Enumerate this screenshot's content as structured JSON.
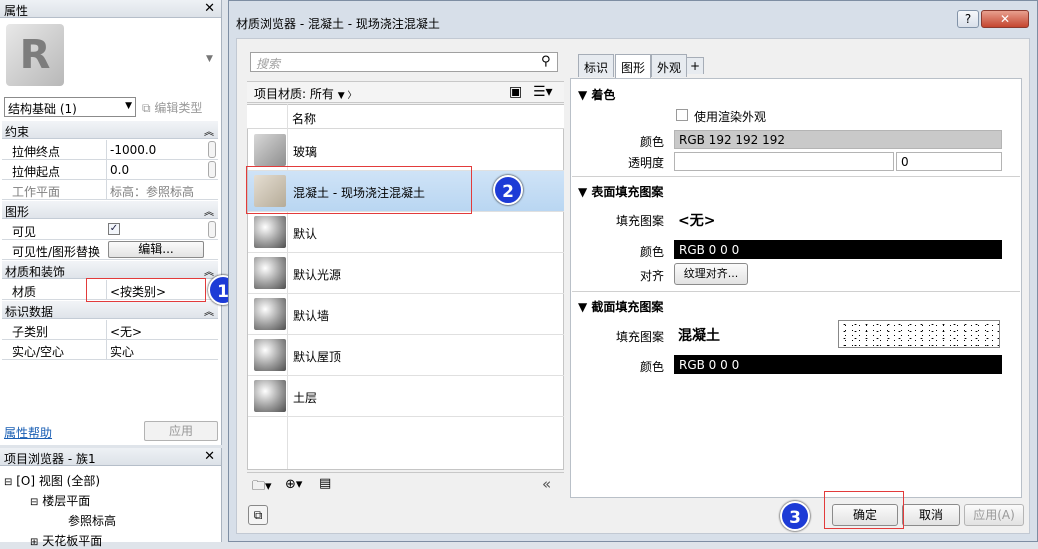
{
  "properties": {
    "title": "属性",
    "type_selector": "结构基础 (1)",
    "edit_type": "编辑类型",
    "sections": {
      "constraints": "约束",
      "graphics": "图形",
      "materials": "材质和装饰",
      "identity": "标识数据"
    },
    "rows": {
      "extrusion_end": {
        "label": "拉伸终点",
        "value": "-1000.0"
      },
      "extrusion_start": {
        "label": "拉伸起点",
        "value": "0.0"
      },
      "work_plane": {
        "label": "工作平面",
        "value": "标高：参照标高"
      },
      "visible": {
        "label": "可见",
        "value": "✓"
      },
      "vis_override": {
        "label": "可见性/图形替换",
        "button": "编辑..."
      },
      "material": {
        "label": "材质",
        "value": "<按类别>"
      },
      "subcategory": {
        "label": "子类别",
        "value": "<无>"
      },
      "solid_void": {
        "label": "实心/空心",
        "value": "实心"
      }
    },
    "help_link": "属性帮助",
    "apply": "应用"
  },
  "project_browser": {
    "title": "项目浏览器 - 族1",
    "items": [
      "视图 (全部)",
      "楼层平面",
      "参照标高",
      "天花板平面"
    ]
  },
  "dialog": {
    "title": "材质浏览器 - 混凝土 - 现场浇注混凝土",
    "help": "?",
    "search_placeholder": "搜索",
    "library": "项目材质: 所有",
    "column_name": "名称",
    "materials": [
      {
        "name": "玻璃",
        "icon": "glass"
      },
      {
        "name": "混凝土 - 现场浇注混凝土",
        "icon": "concrete",
        "selected": true
      },
      {
        "name": "默认",
        "icon": "sphere"
      },
      {
        "name": "默认光源",
        "icon": "sphere"
      },
      {
        "name": "默认墙",
        "icon": "sphere"
      },
      {
        "name": "默认屋顶",
        "icon": "sphere"
      },
      {
        "name": "土层",
        "icon": "sphere"
      }
    ],
    "tabs": [
      "标识",
      "图形",
      "外观",
      "+"
    ],
    "shading": {
      "heading": "▼ 着色",
      "use_render": "使用渲染外观",
      "color_label": "颜色",
      "color_value": "RGB 192 192 192",
      "transparency_label": "透明度",
      "transparency_value": "0"
    },
    "surface": {
      "heading": "▼ 表面填充图案",
      "pattern_label": "填充图案",
      "pattern_value": "<无>",
      "color_label": "颜色",
      "color_value": "RGB 0 0 0",
      "align_label": "对齐",
      "align_button": "纹理对齐..."
    },
    "cut": {
      "heading": "▼ 截面填充图案",
      "pattern_label": "填充图案",
      "pattern_value": "混凝土",
      "color_label": "颜色",
      "color_value": "RGB 0 0 0"
    },
    "ok": "确定",
    "cancel": "取消",
    "apply": "应用(A)"
  },
  "annotations": [
    "1",
    "2",
    "3"
  ],
  "colors": {
    "badge": "#1d3bd6",
    "highlight_box": "#e23b3b",
    "selection": "#c3dcf5"
  }
}
